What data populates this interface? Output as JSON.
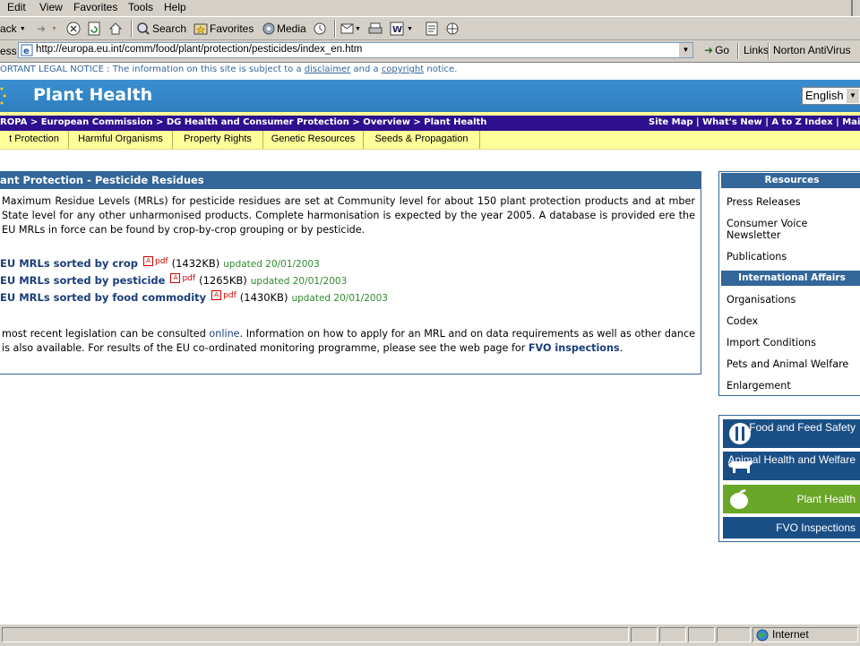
{
  "browser": {
    "menu": [
      "Edit",
      "View",
      "Favorites",
      "Tools",
      "Help"
    ],
    "toolbar": {
      "back": "ack",
      "search": "Search",
      "favorites": "Favorites",
      "media": "Media"
    },
    "address_label": "ess",
    "url": "http://europa.eu.int/comm/food/plant/protection/pesticides/index_en.htm",
    "go": "Go",
    "links": "Links",
    "norton": "Norton AntiVirus",
    "status_zone": "Internet"
  },
  "page": {
    "legal": {
      "prefix": "ORTANT LEGAL NOTICE : The information on this site is subject to a ",
      "disclaimer": "disclaimer",
      "middle": " and a ",
      "copyright": "copyright",
      "suffix": " notice."
    },
    "banner_title": "Plant Health",
    "language": "English",
    "breadcrumb": "ROPA > European Commission > DG Health and Consumer Protection > Overview > Plant Health",
    "top_links": "Site Map | What's New | A to Z Index | Mailbox",
    "tabs": [
      "t Protection",
      "Harmful Organisms",
      "Property Rights",
      "Genetic Resources",
      "Seeds & Propagation"
    ],
    "content": {
      "title": "ant Protection - Pesticide Residues",
      "intro": "Maximum Residue Levels (MRLs) for pesticide residues are set at Community level for about 150 plant protection products and at mber State level for any other unharmonised products. Complete harmonisation is expected by the year 2005. A database is provided ere the EU MRLs in force can be found by crop-by-crop grouping or by pesticide.",
      "mrl_links": [
        {
          "label": "EU MRLs sorted by crop",
          "pdf": "pdf",
          "size": "(1432KB)",
          "updated": "updated 20/01/2003"
        },
        {
          "label": "EU MRLs sorted by pesticide",
          "pdf": "pdf",
          "size": "(1265KB)",
          "updated": "updated 20/01/2003"
        },
        {
          "label": "EU MRLs sorted by food commodity",
          "pdf": "pdf",
          "size": "(1430KB)",
          "updated": "updated 20/01/2003"
        }
      ],
      "legislation": {
        "p1": " most recent legislation can be consulted ",
        "online": "online",
        "p2": ". Information on how to apply for an MRL and on data requirements as well as other dance is also available. For results of the EU co-ordinated monitoring programme, please see the web page for ",
        "fvo": "FVO inspections",
        "p3": "."
      }
    },
    "sidebar": {
      "resources_title": "Resources",
      "resources": [
        "Press Releases",
        "Consumer Voice Newsletter",
        "Publications"
      ],
      "intl_title": "International Affairs",
      "intl": [
        "Organisations",
        "Codex",
        "Import Conditions",
        "Pets and Animal Welfare",
        "Enlargement"
      ]
    },
    "promo": [
      {
        "label": "Food and Feed Safety",
        "icon": "cutlery-icon",
        "color": "#1a4f86"
      },
      {
        "label": "Animal Health and Welfare",
        "icon": "cow-icon",
        "color": "#1a4f86"
      },
      {
        "label": "Plant Health",
        "icon": "apple-icon",
        "color": "#6aa627"
      },
      {
        "label": "FVO Inspections",
        "icon": "",
        "color": "#1a4f86"
      }
    ]
  }
}
